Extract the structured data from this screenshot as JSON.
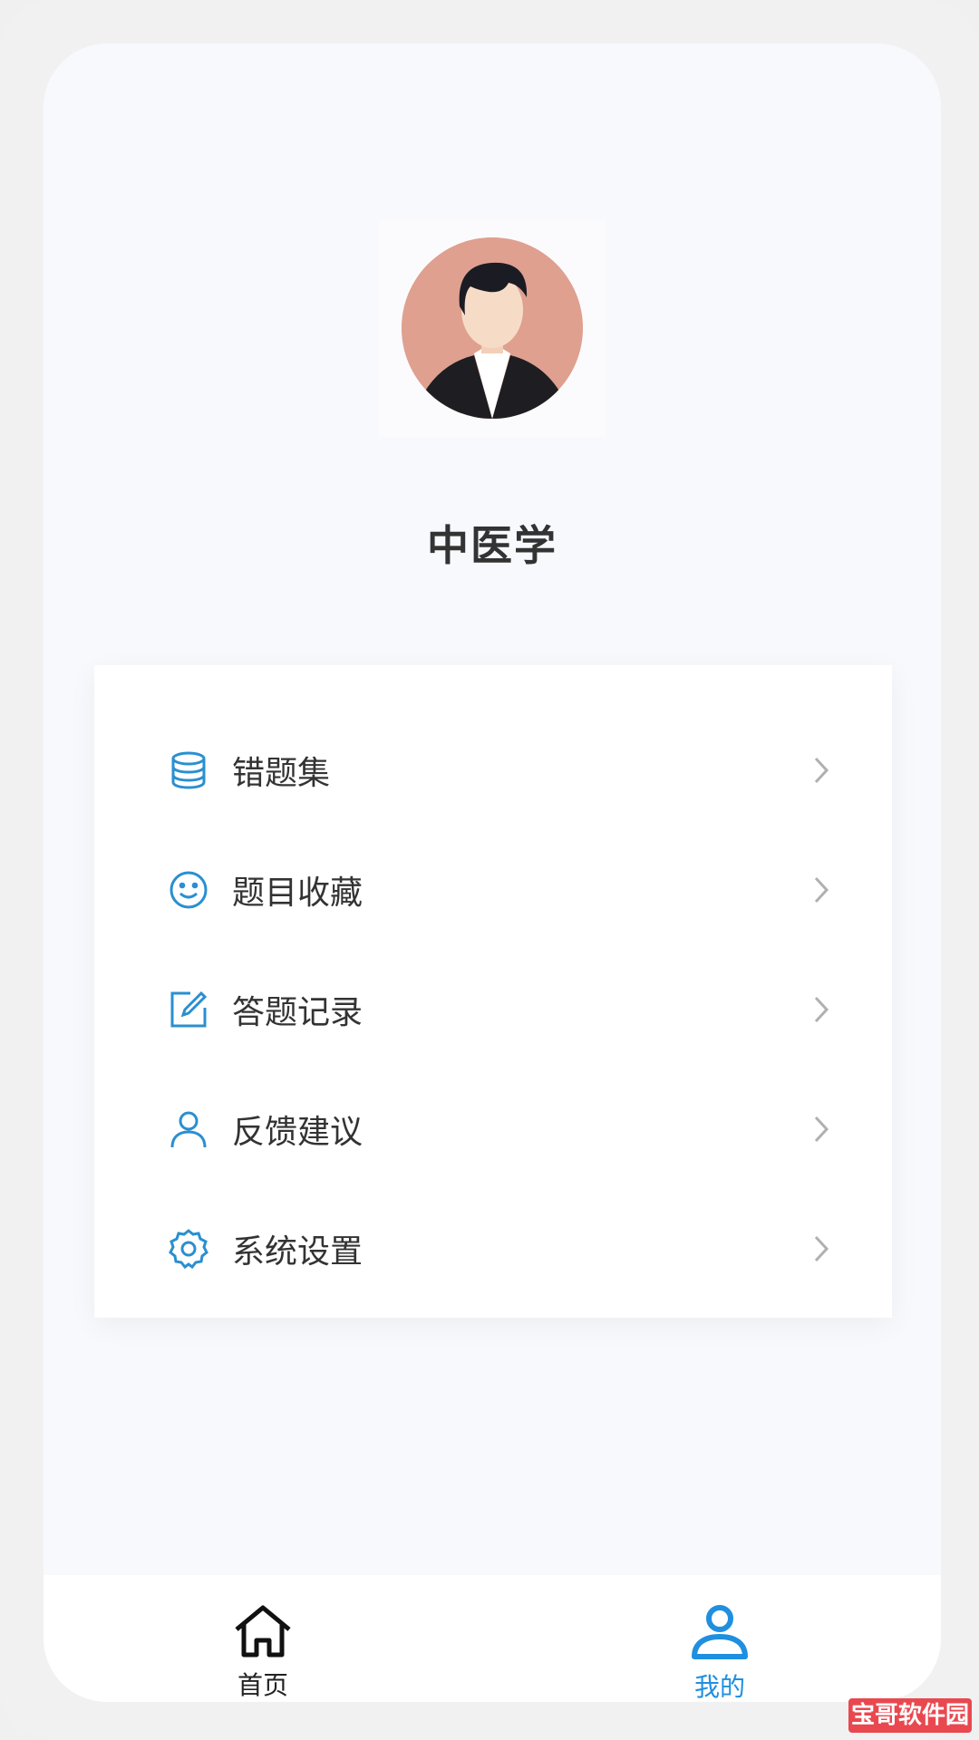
{
  "profile": {
    "name": "中医学"
  },
  "menu": {
    "items": [
      {
        "label": "错题集",
        "icon": "database-icon"
      },
      {
        "label": "题目收藏",
        "icon": "smiley-icon"
      },
      {
        "label": "答题记录",
        "icon": "edit-icon"
      },
      {
        "label": "反馈建议",
        "icon": "user-icon"
      },
      {
        "label": "系统设置",
        "icon": "gear-icon"
      }
    ]
  },
  "tabs": [
    {
      "label": "首页",
      "icon": "home-icon",
      "active": false
    },
    {
      "label": "我的",
      "icon": "user-icon",
      "active": true
    }
  ],
  "colors": {
    "accent": "#1f8fe0",
    "icon_blue": "#2a8fd0",
    "text": "#333333",
    "arrow": "#b0b0b0"
  },
  "watermark": "宝哥软件园"
}
